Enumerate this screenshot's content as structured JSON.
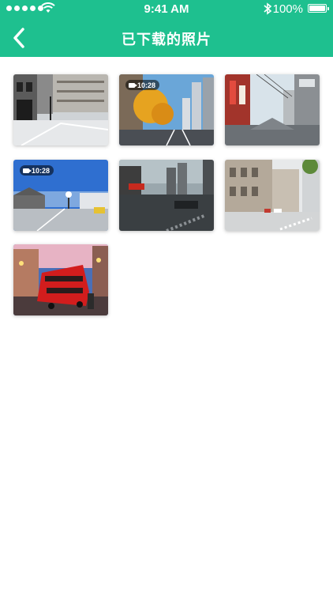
{
  "status_bar": {
    "time": "9:41 AM",
    "battery": "100%"
  },
  "header": {
    "title": "已下载的照片",
    "back_icon": "chevron-left-icon"
  },
  "colors": {
    "brand": "#1ec08f"
  },
  "photos": [
    {
      "type": "photo",
      "duration": ""
    },
    {
      "type": "video",
      "duration": "10:28"
    },
    {
      "type": "photo",
      "duration": ""
    },
    {
      "type": "video",
      "duration": "10:28"
    },
    {
      "type": "photo",
      "duration": ""
    },
    {
      "type": "photo",
      "duration": ""
    },
    {
      "type": "photo",
      "duration": ""
    }
  ]
}
